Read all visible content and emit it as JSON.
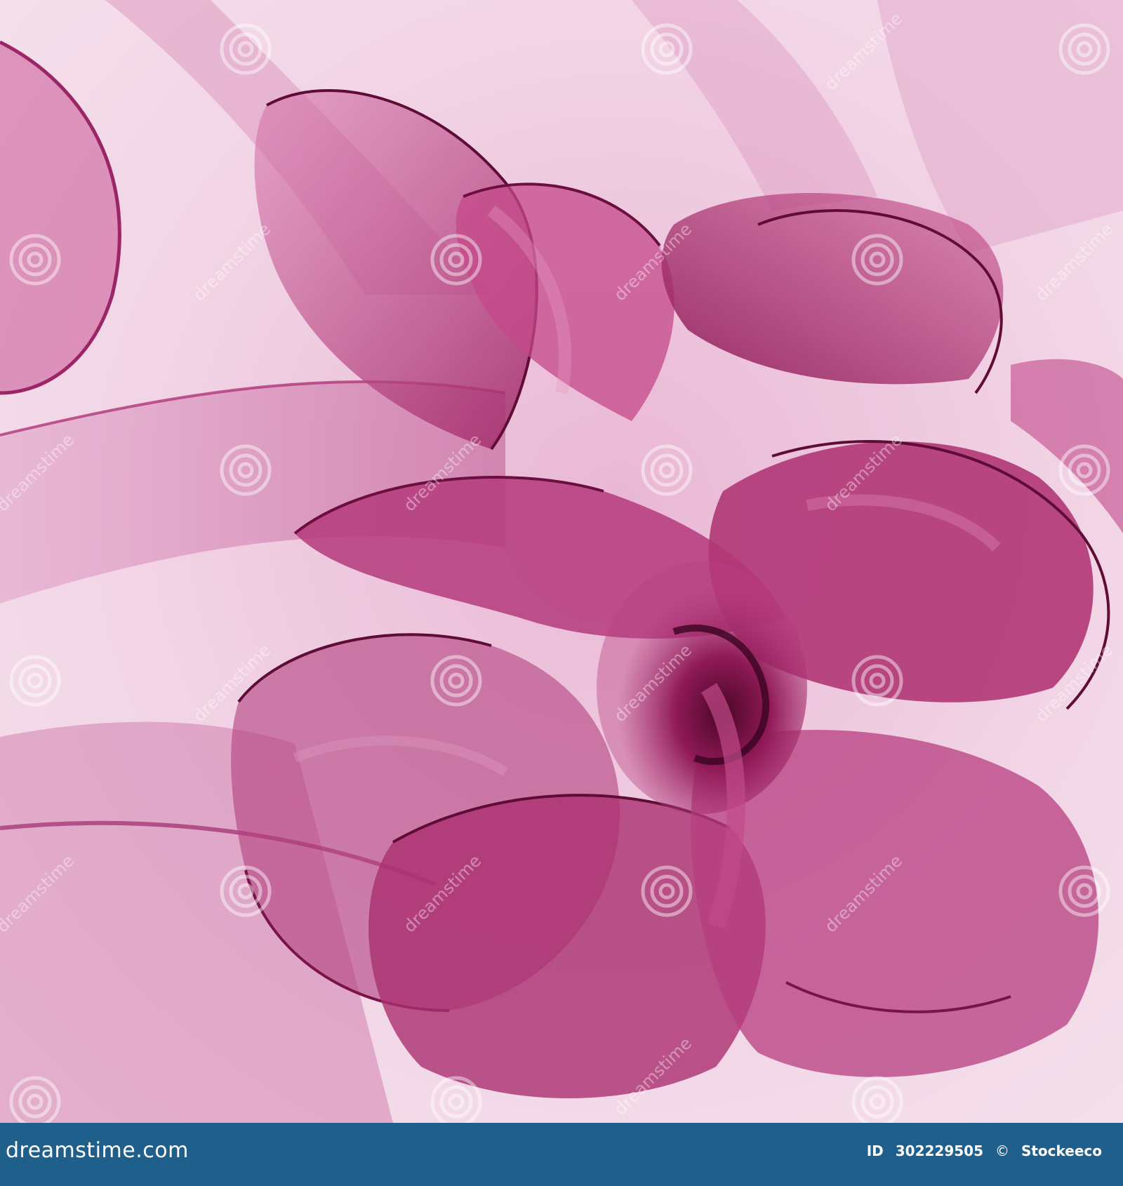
{
  "photo": {
    "subject": "sheer magenta organza fabric ruffles",
    "colors": {
      "background": "#f3dbe9",
      "fabric_light": "#d76fa6",
      "fabric_mid": "#b73e80",
      "fabric_dark": "#7d1149",
      "edge": "#5f0c36"
    }
  },
  "watermark": {
    "text": "dreamstime",
    "icon": "spiral-logo-icon"
  },
  "footer": {
    "brand": "dreamstime.com",
    "id_label": "ID",
    "id_value": "302229505",
    "copyright_symbol": "©",
    "author": "Stockeeco",
    "background": "#1f5f8b"
  }
}
